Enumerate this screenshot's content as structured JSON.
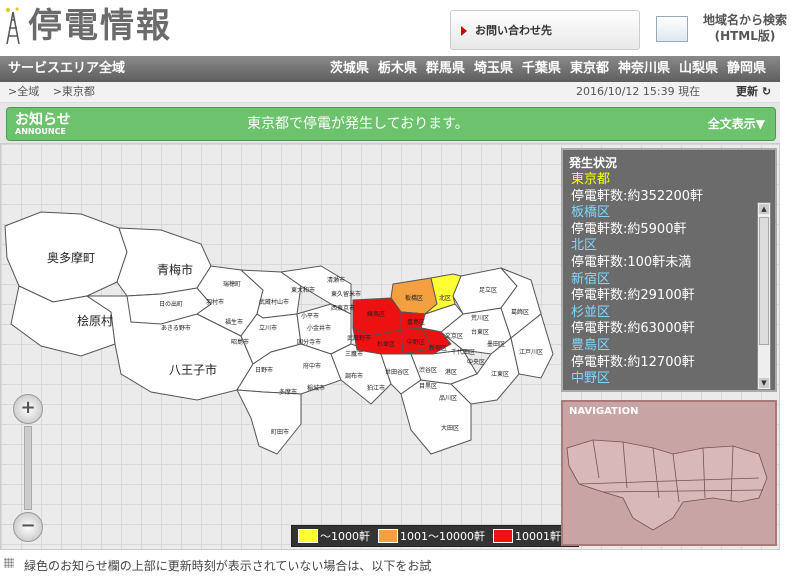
{
  "header": {
    "logo": "停電情報",
    "contact_label": "お問い合わせ先",
    "search_link": [
      "地域名から検索",
      "(HTML版)"
    ]
  },
  "navbar": {
    "service_area": "サービスエリア全域",
    "prefectures": [
      "茨城県",
      "栃木県",
      "群馬県",
      "埼玉県",
      "千葉県",
      "東京都",
      "神奈川県",
      "山梨県",
      "静岡県"
    ]
  },
  "breadcrumb": {
    "items": [
      ">全域",
      ">東京都"
    ],
    "timestamp": "2016/10/12 15:39 現在",
    "refresh": "更新"
  },
  "announce": {
    "title": "お知らせ",
    "subtitle": "ANNOUNCE",
    "message": "東京都で停電が発生しております。",
    "full_text": "全文表示▼"
  },
  "status_panel": {
    "heading": "発生状況",
    "lines": [
      {
        "text": "東京都",
        "kind": "pref"
      },
      {
        "text": "停電軒数:約352200軒",
        "kind": "count"
      },
      {
        "text": "板橋区",
        "kind": "ward"
      },
      {
        "text": "停電軒数:約5900軒",
        "kind": "count"
      },
      {
        "text": "北区",
        "kind": "ward"
      },
      {
        "text": "停電軒数:100軒未満",
        "kind": "count"
      },
      {
        "text": "新宿区",
        "kind": "ward"
      },
      {
        "text": "停電軒数:約29100軒",
        "kind": "count"
      },
      {
        "text": "杉並区",
        "kind": "ward"
      },
      {
        "text": "停電軒数:約63000軒",
        "kind": "count"
      },
      {
        "text": "豊島区",
        "kind": "ward"
      },
      {
        "text": "停電軒数:約12700軒",
        "kind": "count"
      },
      {
        "text": "中野区",
        "kind": "ward"
      }
    ]
  },
  "navigation_panel": {
    "heading": "NAVIGATION"
  },
  "map": {
    "large_labels": [
      "奥多摩町",
      "青梅市",
      "桧原村",
      "八王子市"
    ],
    "small_labels": [
      "日の出町",
      "あきる野市",
      "羽村市",
      "瑞穂町",
      "武蔵村山市",
      "東大和市",
      "清瀬市",
      "東久留米市",
      "西東京市",
      "練馬区",
      "板橋区",
      "北区",
      "足立区",
      "葛飾区",
      "江戸川区",
      "荒川区",
      "台東区",
      "墨田区",
      "江東区",
      "文京区",
      "中央区",
      "千代田区",
      "港区",
      "渋谷区",
      "目黒区",
      "品川区",
      "大田区",
      "世田谷区",
      "杉並区",
      "中野区",
      "新宿区",
      "豊島区",
      "三鷹市",
      "武蔵野市",
      "小金井市",
      "国分寺市",
      "小平市",
      "立川市",
      "昭島市",
      "福生市",
      "日野市",
      "府中市",
      "調布市",
      "狛江市",
      "稲城市",
      "多摩市",
      "町田市"
    ],
    "colors": {
      "low": "#ffff33",
      "mid": "#f4a040",
      "high": "#ee1111",
      "base": "#ffffff"
    }
  },
  "legend": {
    "items": [
      {
        "label": "〜1000軒",
        "color": "#ffff33"
      },
      {
        "label": "1001〜10000軒",
        "color": "#f4a040"
      },
      {
        "label": "10001軒〜",
        "color": "#ee1111"
      }
    ]
  },
  "footer": {
    "text": "緑色のお知らせ欄の上部に更新時刻が表示されていない場合は、以下をお試"
  }
}
